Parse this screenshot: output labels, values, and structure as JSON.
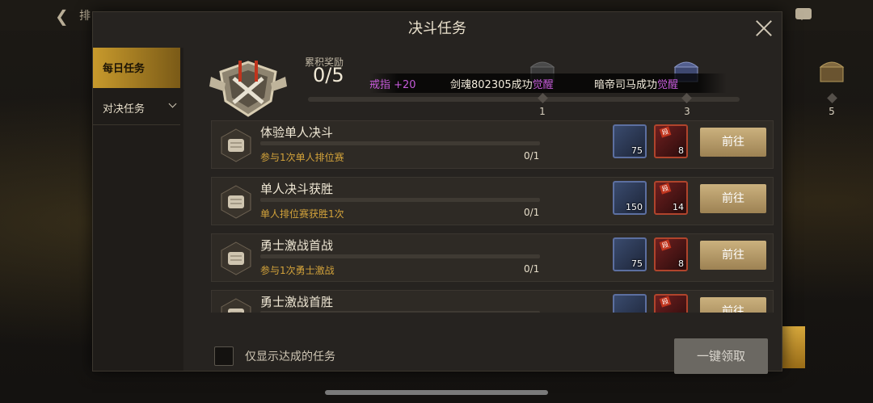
{
  "background": {
    "top_title": "排"
  },
  "dialog": {
    "title": "决斗任务",
    "sidebar": {
      "tabs": [
        "每日任务",
        "对决任务"
      ]
    },
    "progress": {
      "label": "累积奖励",
      "value": "0/5",
      "nodes": [
        "1",
        "3",
        "5"
      ],
      "fraction": 0
    },
    "marquee": {
      "segments": [
        {
          "text": "戒指 +20",
          "color": "#c45ad8"
        },
        {
          "text": "剑魂802305成功",
          "color": "#f3ecdc"
        },
        {
          "text": "觉醒",
          "color": "#c45ad8"
        },
        {
          "text": "暗帝司马成功",
          "color": "#f3ecdc"
        },
        {
          "text": "觉醒",
          "color": "#c45ad8"
        }
      ]
    },
    "tasks": [
      {
        "name": "体验单人决斗",
        "desc": "参与1次单人排位赛",
        "count": "0/1",
        "reward1": "75",
        "reward2": "8",
        "button": "前往"
      },
      {
        "name": "单人决斗获胜",
        "desc": "单人排位赛获胜1次",
        "count": "0/1",
        "reward1": "150",
        "reward2": "14",
        "button": "前往"
      },
      {
        "name": "勇士激战首战",
        "desc": "参与1次勇士激战",
        "count": "0/1",
        "reward1": "75",
        "reward2": "8",
        "button": "前往"
      },
      {
        "name": "勇士激战首胜",
        "desc": "",
        "count": "",
        "reward1": "",
        "reward2": "",
        "button": "前往"
      }
    ],
    "reward_tag": "段",
    "filter_label": "仅显示达成的任务",
    "claim_all": "一键领取"
  },
  "colors": {
    "accent_gold": "#c89a2c",
    "desc_gold": "#d2a23a",
    "highlight_purple": "#c45ad8"
  }
}
